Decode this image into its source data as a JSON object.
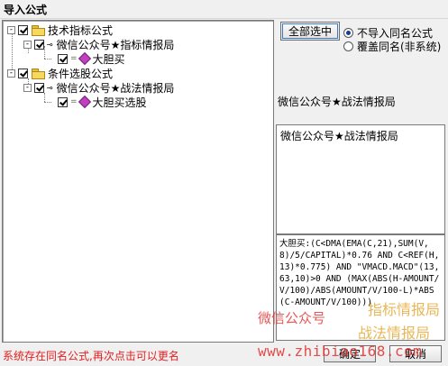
{
  "window": {
    "title": "导入公式"
  },
  "tree": {
    "groups": [
      {
        "label": "技术指标公式",
        "expander": "-",
        "child": {
          "label": "微信公众号★指标情报局",
          "expander": "-",
          "leaf": {
            "label": "大胆买",
            "prefix": "="
          }
        }
      },
      {
        "label": "条件选股公式",
        "expander": "-",
        "child": {
          "label": "微信公众号★战法情报局",
          "expander": "-",
          "leaf": {
            "label": "大胆买选股",
            "prefix": "="
          }
        }
      }
    ]
  },
  "options": {
    "select_all_label": "全部选中",
    "radio_no_import": "不导入同名公式",
    "radio_overwrite": "覆盖同名(非系统)",
    "selected": "no_import"
  },
  "details": {
    "name_label": "微信公众号★战法情报局",
    "name_value": "微信公众号★战法情报局",
    "formula": "大胆买:(C<DMA(EMA(C,21),SUM(V,8)/5/CAPITAL)*0.76 AND C<REF(H,13)*0.775) AND \"VMACD.MACD\"(13,63,10)>0 AND (MAX(ABS(H-AMOUNT/V/100)/ABS(AMOUNT/V/100-L)*ABS(C-AMOUNT/V/100)))"
  },
  "watermarks": {
    "wechat": "微信公众号",
    "bureau1": "指标情报局",
    "bureau2": "战法情报局",
    "site": "www.zhibiao168.com"
  },
  "status": {
    "message": "系统存在同名公式,再次点击可以更名"
  },
  "buttons": {
    "ok": "确定",
    "cancel": "取消"
  }
}
